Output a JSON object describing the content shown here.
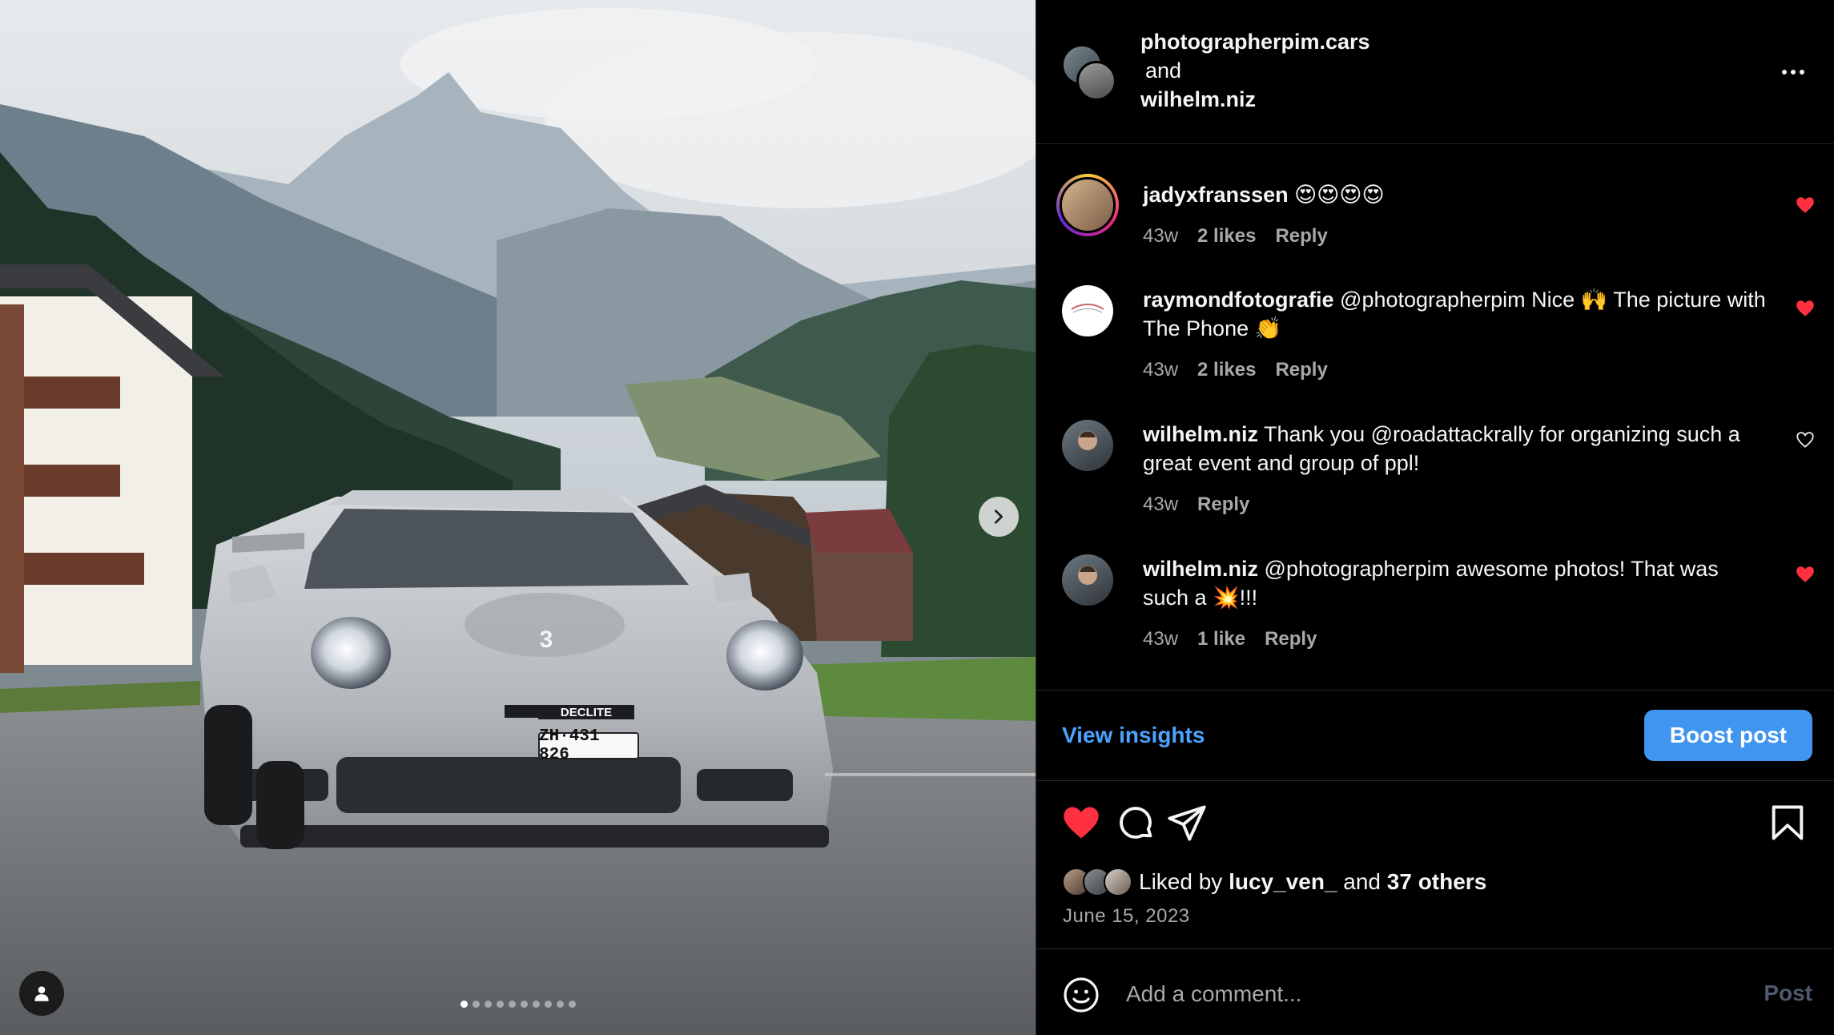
{
  "photo": {
    "carousel_count": 10,
    "carousel_active_index": 0,
    "license_plate": "ZH·431 826",
    "sponsor_badge": "DECLITE",
    "hood_number": "3"
  },
  "header": {
    "user1": "photographerpim.cars",
    "and_text": "and",
    "user2": "wilhelm.niz"
  },
  "comments": [
    {
      "user": "jadyxfranssen",
      "text": "😍😍😍😍",
      "time": "43w",
      "likes": "2 likes",
      "reply": "Reply",
      "liked": true
    },
    {
      "user": "raymondfotografie",
      "text": "@photographerpim Nice 🙌 The picture with The Phone 👏",
      "time": "43w",
      "likes": "2 likes",
      "reply": "Reply",
      "liked": true
    },
    {
      "user": "wilhelm.niz",
      "text": "Thank you @roadattackrally for organizing such a great event and group of ppl!",
      "time": "43w",
      "likes": "",
      "reply": "Reply",
      "liked": false
    },
    {
      "user": "wilhelm.niz",
      "text": "@photographerpim awesome photos! That was such a 💥!!!",
      "time": "43w",
      "likes": "1 like",
      "reply": "Reply",
      "liked": true
    }
  ],
  "insights": {
    "view_label": "View insights",
    "boost_label": "Boost post"
  },
  "likes": {
    "prefix": "Liked by",
    "user": "lucy_ven_",
    "connector": "and",
    "others": "37 others",
    "date": "June 15, 2023"
  },
  "compose": {
    "placeholder": "Add a comment...",
    "post_label": "Post"
  },
  "colors": {
    "like_red": "#ff3040",
    "link_blue": "#4aa3ff",
    "boost_blue": "#3f95ef",
    "panel_bg": "#000000"
  }
}
